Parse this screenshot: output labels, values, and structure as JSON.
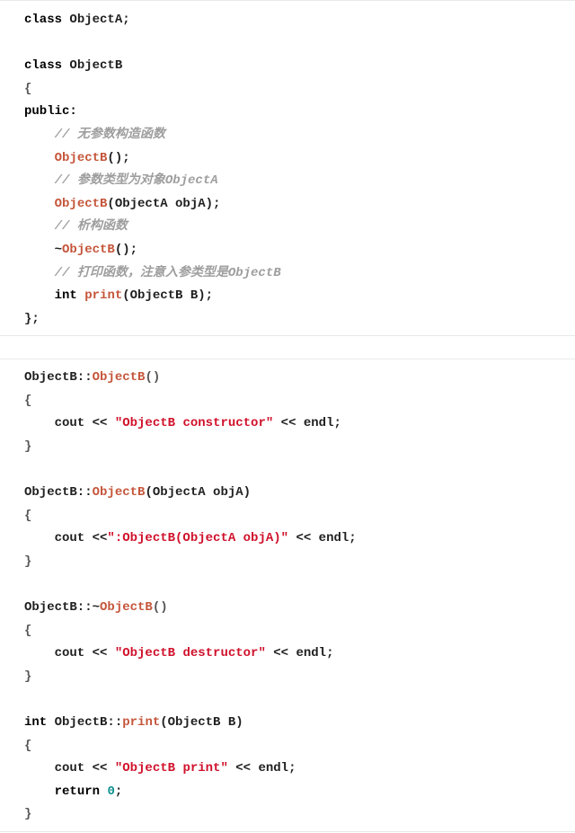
{
  "colors": {
    "keyword": "#000000",
    "function": "#c5563b",
    "string": "#d0112b",
    "comment": "#9e9e9e",
    "number": "#0d8f8f",
    "text": "#1f1f1f",
    "border": "#e9e9e9"
  },
  "blocks": [
    {
      "id": "declaration",
      "lines": [
        [
          {
            "t": "class",
            "c": "keyword"
          },
          {
            "t": " ObjectA;",
            "c": "plain"
          }
        ],
        [],
        [
          {
            "t": "class",
            "c": "keyword"
          },
          {
            "t": " ObjectB",
            "c": "plain"
          }
        ],
        [
          {
            "t": "{",
            "c": "paren"
          }
        ],
        [
          {
            "t": "public:",
            "c": "keyword"
          }
        ],
        [
          {
            "t": "    ",
            "c": "plain"
          },
          {
            "t": "// 无参数构造函数",
            "c": "comment"
          }
        ],
        [
          {
            "t": "    ",
            "c": "plain"
          },
          {
            "t": "ObjectB",
            "c": "func"
          },
          {
            "t": "();",
            "c": "plain"
          }
        ],
        [
          {
            "t": "    ",
            "c": "plain"
          },
          {
            "t": "// 参数类型为对象ObjectA",
            "c": "comment"
          }
        ],
        [
          {
            "t": "    ",
            "c": "plain"
          },
          {
            "t": "ObjectB",
            "c": "func"
          },
          {
            "t": "(ObjectA objA);",
            "c": "plain"
          }
        ],
        [
          {
            "t": "    ",
            "c": "plain"
          },
          {
            "t": "// 析构函数",
            "c": "comment"
          }
        ],
        [
          {
            "t": "    ~",
            "c": "plain"
          },
          {
            "t": "ObjectB",
            "c": "func"
          },
          {
            "t": "();",
            "c": "plain"
          }
        ],
        [
          {
            "t": "    ",
            "c": "plain"
          },
          {
            "t": "// 打印函数，注意入参类型是ObjectB",
            "c": "comment"
          }
        ],
        [
          {
            "t": "    ",
            "c": "plain"
          },
          {
            "t": "int",
            "c": "keyword"
          },
          {
            "t": " ",
            "c": "plain"
          },
          {
            "t": "print",
            "c": "func"
          },
          {
            "t": "(ObjectB B);",
            "c": "plain"
          }
        ],
        [
          {
            "t": "};",
            "c": "plain"
          }
        ]
      ]
    },
    {
      "id": "definitions",
      "lines": [
        [
          {
            "t": "ObjectB::",
            "c": "plain"
          },
          {
            "t": "ObjectB",
            "c": "func"
          },
          {
            "t": "()",
            "c": "paren"
          }
        ],
        [
          {
            "t": "{",
            "c": "paren"
          }
        ],
        [
          {
            "t": "    cout << ",
            "c": "plain"
          },
          {
            "t": "\"ObjectB constructor\"",
            "c": "string"
          },
          {
            "t": " << endl;",
            "c": "plain"
          }
        ],
        [
          {
            "t": "}",
            "c": "paren"
          }
        ],
        [],
        [
          {
            "t": "ObjectB::",
            "c": "plain"
          },
          {
            "t": "ObjectB",
            "c": "func"
          },
          {
            "t": "(ObjectA objA)",
            "c": "plain"
          }
        ],
        [
          {
            "t": "{",
            "c": "paren"
          }
        ],
        [
          {
            "t": "    cout <<",
            "c": "plain"
          },
          {
            "t": "\":ObjectB(ObjectA objA)\"",
            "c": "string"
          },
          {
            "t": " << endl;",
            "c": "plain"
          }
        ],
        [
          {
            "t": "}",
            "c": "paren"
          }
        ],
        [],
        [
          {
            "t": "ObjectB::~",
            "c": "plain"
          },
          {
            "t": "ObjectB",
            "c": "func"
          },
          {
            "t": "()",
            "c": "paren"
          }
        ],
        [
          {
            "t": "{",
            "c": "paren"
          }
        ],
        [
          {
            "t": "    cout << ",
            "c": "plain"
          },
          {
            "t": "\"ObjectB destructor\"",
            "c": "string"
          },
          {
            "t": " << endl;",
            "c": "plain"
          }
        ],
        [
          {
            "t": "}",
            "c": "paren"
          }
        ],
        [],
        [
          {
            "t": "int",
            "c": "keyword"
          },
          {
            "t": " ObjectB::",
            "c": "plain"
          },
          {
            "t": "print",
            "c": "func"
          },
          {
            "t": "(ObjectB B)",
            "c": "plain"
          }
        ],
        [
          {
            "t": "{",
            "c": "paren"
          }
        ],
        [
          {
            "t": "    cout << ",
            "c": "plain"
          },
          {
            "t": "\"ObjectB print\"",
            "c": "string"
          },
          {
            "t": " << endl;",
            "c": "plain"
          }
        ],
        [
          {
            "t": "    ",
            "c": "plain"
          },
          {
            "t": "return",
            "c": "keyword"
          },
          {
            "t": " ",
            "c": "plain"
          },
          {
            "t": "0",
            "c": "number"
          },
          {
            "t": ";",
            "c": "plain"
          }
        ],
        [
          {
            "t": "}",
            "c": "paren"
          }
        ]
      ]
    }
  ]
}
